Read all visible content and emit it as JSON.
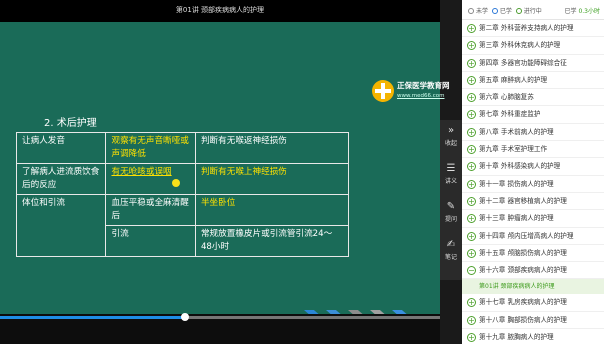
{
  "video": {
    "title": "第01讲  颈部疾病病人的护理"
  },
  "slide": {
    "logo_name": "正保医学教育网",
    "logo_url": "www.med66.com",
    "section_title": "2. 术后护理",
    "rows": [
      {
        "c1": "让病人发音",
        "c2": "观察有无声音嘶哑或声调降低",
        "c3": "判断有无喉返神经损伤"
      },
      {
        "c1": "了解病人进流质饮食后的反应",
        "c2": "有无呛咳或误咽",
        "c3": "判断有无喉上神经损伤"
      },
      {
        "c1": "体位和引流",
        "c2": "血压平稳或全麻清醒后",
        "c3": "半坐卧位"
      },
      {
        "c1": "",
        "c2": "引流",
        "c3": "常规放置橡皮片或引流管引流24～48小时"
      }
    ]
  },
  "tools": [
    {
      "label": "收起",
      "icon": "chevron-right-icon"
    },
    {
      "label": "讲义",
      "icon": "document-icon"
    },
    {
      "label": "提问",
      "icon": "question-icon"
    },
    {
      "label": "笔记",
      "icon": "note-icon"
    }
  ],
  "legend": {
    "unlearned": "未学",
    "learned": "已学",
    "in_progress": "进行中",
    "studied_label": "已学",
    "studied_value": "0.3小时"
  },
  "chapters": [
    {
      "label": "第二章  外科营养支持病人的护理",
      "state": "plus"
    },
    {
      "label": "第三章  外科休克病人的护理",
      "state": "plus"
    },
    {
      "label": "第四章  多器官功能障碍综合征",
      "state": "plus"
    },
    {
      "label": "第五章  麻醉病人的护理",
      "state": "plus"
    },
    {
      "label": "第六章  心肺脑复苏",
      "state": "plus"
    },
    {
      "label": "第七章  外科重症监护",
      "state": "plus"
    },
    {
      "label": "第八章  手术前病人的护理",
      "state": "plus"
    },
    {
      "label": "第九章  手术室护理工作",
      "state": "plus"
    },
    {
      "label": "第十章  外科感染病人的护理",
      "state": "plus"
    },
    {
      "label": "第十一章  损伤病人的护理",
      "state": "plus"
    },
    {
      "label": "第十二章  器官移植病人的护理",
      "state": "plus"
    },
    {
      "label": "第十三章  肿瘤病人的护理",
      "state": "plus"
    },
    {
      "label": "第十四章  颅内压增高病人的护理",
      "state": "plus"
    },
    {
      "label": "第十五章  颅脑损伤病人的护理",
      "state": "plus"
    },
    {
      "label": "第十六章  颈部疾病病人的护理",
      "state": "minus"
    },
    {
      "label": "第十七章  乳房疾病病人的护理",
      "state": "plus"
    },
    {
      "label": "第十八章  胸部损伤病人的护理",
      "state": "plus"
    },
    {
      "label": "第十九章  脓胸病人的护理",
      "state": "plus"
    }
  ],
  "active_lesson": "第01讲  颈部疾病病人的护理",
  "colors": {
    "slide_bg": "#1a6b58",
    "highlight_text": "#ffe100",
    "arrow_colors": [
      "#2a86d6",
      "#3b8ed8",
      "#8c8c8c",
      "#a0a0a0",
      "#3a8fe0"
    ],
    "progress": "#1e8ee6",
    "panel_accent": "#4ea12e"
  }
}
